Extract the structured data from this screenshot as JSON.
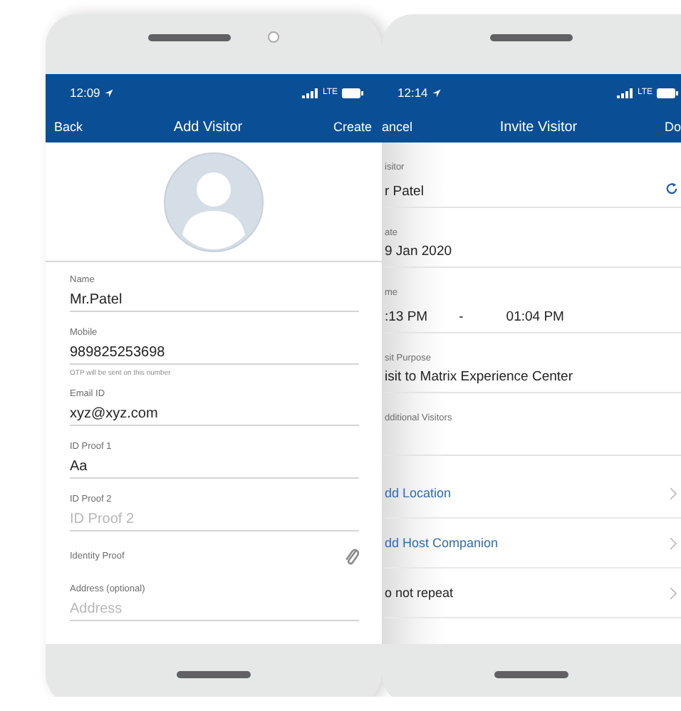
{
  "add_visitor_phone": {
    "status_bar": {
      "time": "12:09",
      "network": "LTE"
    },
    "nav_bar": {
      "back": "Back",
      "title": "Add Visitor",
      "action": "Create"
    },
    "fields": [
      {
        "kind": "text",
        "label": "Name",
        "value": "Mr.Patel"
      },
      {
        "kind": "text",
        "label": "Mobile",
        "value": "989825253698",
        "hint": "OTP will be sent on this number"
      },
      {
        "kind": "text",
        "label": "Email ID",
        "value": "xyz@xyz.com"
      },
      {
        "kind": "text",
        "label": "ID Proof 1",
        "value": "Aa"
      },
      {
        "kind": "text",
        "label": "ID Proof 2",
        "placeholder": "ID Proof 2"
      },
      {
        "kind": "attachment",
        "label": "Identity Proof"
      },
      {
        "kind": "text",
        "label": "Address (optional)",
        "placeholder": "Address"
      }
    ]
  },
  "invite_visitor_phone": {
    "status_bar": {
      "time": "12:14",
      "network": "LTE"
    },
    "nav_bar": {
      "left": "ancel",
      "title": "Invite Visitor",
      "right": "Do"
    },
    "fields": [
      {
        "kind": "visitor",
        "label": "isitor",
        "value": "r Patel"
      },
      {
        "kind": "text",
        "label": "ate",
        "value": "9 Jan 2020"
      },
      {
        "kind": "time",
        "label": "me",
        "start": ":13 PM",
        "separator": "-",
        "end": "01:04 PM"
      },
      {
        "kind": "text",
        "label": "sit Purpose",
        "value": "isit to Matrix Experience Center"
      },
      {
        "kind": "empty",
        "label": "dditional Visitors"
      }
    ],
    "options": [
      {
        "kind": "link",
        "label": "dd Location"
      },
      {
        "kind": "link",
        "label": "dd Host Companion"
      },
      {
        "kind": "plain",
        "label": "o not repeat"
      }
    ]
  }
}
